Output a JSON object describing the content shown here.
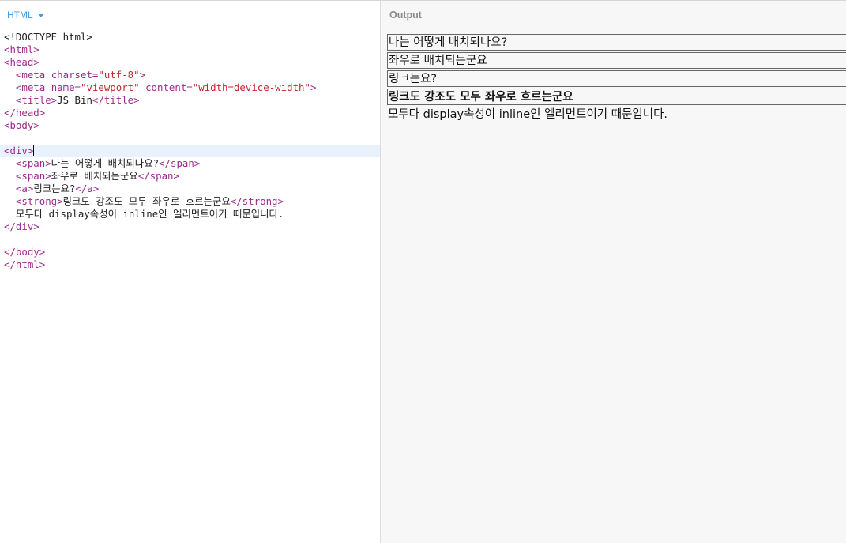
{
  "editor": {
    "language_label": "HTML",
    "lines": [
      [
        {
          "c": "txt",
          "t": "<!DOCTYPE html>"
        }
      ],
      [
        {
          "c": "tag",
          "t": "<html>"
        }
      ],
      [
        {
          "c": "tag",
          "t": "<head>"
        }
      ],
      [
        {
          "c": "txt",
          "t": "  "
        },
        {
          "c": "tag",
          "t": "<meta"
        },
        {
          "c": "attr",
          "t": " charset="
        },
        {
          "c": "str",
          "t": "\"utf-8\""
        },
        {
          "c": "tag",
          "t": ">"
        }
      ],
      [
        {
          "c": "txt",
          "t": "  "
        },
        {
          "c": "tag",
          "t": "<meta"
        },
        {
          "c": "attr",
          "t": " name="
        },
        {
          "c": "str",
          "t": "\"viewport\""
        },
        {
          "c": "attr",
          "t": " content="
        },
        {
          "c": "str",
          "t": "\"width=device-width\""
        },
        {
          "c": "tag",
          "t": ">"
        }
      ],
      [
        {
          "c": "txt",
          "t": "  "
        },
        {
          "c": "tag",
          "t": "<title>"
        },
        {
          "c": "txt",
          "t": "JS Bin"
        },
        {
          "c": "tag",
          "t": "</title>"
        }
      ],
      [
        {
          "c": "tag",
          "t": "</head>"
        }
      ],
      [
        {
          "c": "tag",
          "t": "<body>"
        }
      ],
      [],
      [
        {
          "c": "tag",
          "t": "<div>"
        }
      ],
      [
        {
          "c": "txt",
          "t": "  "
        },
        {
          "c": "tag",
          "t": "<span>"
        },
        {
          "c": "txt",
          "t": "나는 어떻게 배치되나요?"
        },
        {
          "c": "tag",
          "t": "</span>"
        }
      ],
      [
        {
          "c": "txt",
          "t": "  "
        },
        {
          "c": "tag",
          "t": "<span>"
        },
        {
          "c": "txt",
          "t": "좌우로 배치되는군요"
        },
        {
          "c": "tag",
          "t": "</span>"
        }
      ],
      [
        {
          "c": "txt",
          "t": "  "
        },
        {
          "c": "tag",
          "t": "<a>"
        },
        {
          "c": "txt",
          "t": "링크는요?"
        },
        {
          "c": "tag",
          "t": "</a>"
        }
      ],
      [
        {
          "c": "txt",
          "t": "  "
        },
        {
          "c": "tag",
          "t": "<strong>"
        },
        {
          "c": "txt",
          "t": "링크도 강조도 모두 좌우로 흐르는군요"
        },
        {
          "c": "tag",
          "t": "</strong>"
        }
      ],
      [
        {
          "c": "txt",
          "t": "  모두다 display속성이 inline인 엘리먼트이기 때문입니다."
        }
      ],
      [
        {
          "c": "tag",
          "t": "</div>"
        }
      ],
      [],
      [
        {
          "c": "tag",
          "t": "</body>"
        }
      ],
      [
        {
          "c": "tag",
          "t": "</html>"
        }
      ]
    ],
    "active_line": 9
  },
  "output": {
    "title": "Output",
    "span1": "나는 어떻게 배치되나요?",
    "span2": "좌우로 배치되는군요",
    "link": "링크는요?",
    "strong": "링크도 강조도 모두 좌우로 흐르는군요",
    "text": "모두다 display속성이 inline인 엘리먼트이기 때문입니다."
  }
}
